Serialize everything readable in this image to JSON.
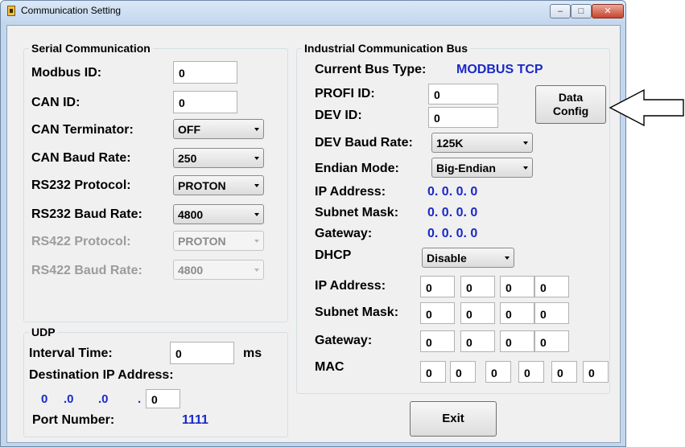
{
  "window": {
    "title": "Communication Setting",
    "min": "–",
    "max": "□",
    "close": "✕"
  },
  "serial": {
    "group_title": "Serial Communication",
    "modbus_id_label": "Modbus ID:",
    "modbus_id_value": "0",
    "can_id_label": "CAN ID:",
    "can_id_value": "0",
    "can_terminator_label": "CAN Terminator:",
    "can_terminator_value": "OFF",
    "can_baud_label": "CAN Baud Rate:",
    "can_baud_value": "250",
    "rs232_protocol_label": "RS232 Protocol:",
    "rs232_protocol_value": "PROTON",
    "rs232_baud_label": "RS232 Baud Rate:",
    "rs232_baud_value": "4800",
    "rs422_protocol_label": "RS422 Protocol:",
    "rs422_protocol_value": "PROTON",
    "rs422_baud_label": "RS422 Baud Rate:",
    "rs422_baud_value": "4800"
  },
  "udp": {
    "group_title": "UDP",
    "interval_label": "Interval Time:",
    "interval_value": "0",
    "interval_unit": "ms",
    "dest_ip_label": "Destination IP Address:",
    "dest_ip": [
      "0",
      ".0",
      ".0",
      ".",
      "0"
    ],
    "port_label": "Port Number:",
    "port_value": "1111"
  },
  "bus": {
    "group_title": "Industrial Communication Bus",
    "current_type_label": "Current Bus Type:",
    "current_type_value": "MODBUS TCP",
    "profi_id_label": "PROFI ID:",
    "profi_id_value": "0",
    "dev_id_label": "DEV ID:",
    "dev_id_value": "0",
    "data_config_label": [
      "Data",
      "Config"
    ],
    "dev_baud_label": "DEV Baud Rate:",
    "dev_baud_value": "125K",
    "endian_label": "Endian Mode:",
    "endian_value": "Big-Endian",
    "ip_label": "IP Address:",
    "ip_value": "0. 0. 0. 0",
    "subnet_label": "Subnet Mask:",
    "subnet_value": "0. 0. 0. 0",
    "gateway_label": "Gateway:",
    "gateway_value": "0. 0. 0. 0",
    "dhcp_label": "DHCP",
    "dhcp_value": "Disable",
    "ip_edit_label": "IP Address:",
    "ip_edit": [
      "0",
      "0",
      "0",
      "0"
    ],
    "subnet_edit_label": "Subnet Mask:",
    "subnet_edit": [
      "0",
      "0",
      "0",
      "0"
    ],
    "gateway_edit_label": "Gateway:",
    "gateway_edit": [
      "0",
      "0",
      "0",
      "0"
    ],
    "mac_label": "MAC",
    "mac": [
      "0",
      "0",
      "0",
      "0",
      "0",
      "0"
    ]
  },
  "exit_label": "Exit",
  "colors": {
    "accent_blue": "#1a29c8",
    "disabled": "#9c9c9c"
  }
}
